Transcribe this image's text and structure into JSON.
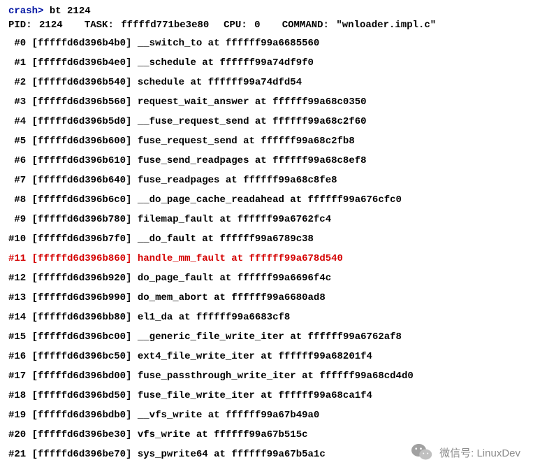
{
  "prompt": {
    "label": "crash>",
    "command": "bt 2124"
  },
  "header": {
    "pid_label": "PID:",
    "pid": "2124",
    "task_label": "TASK:",
    "task": "fffffd771be3e80",
    "cpu_label": "CPU:",
    "cpu": "0",
    "command_label": "COMMAND:",
    "command": "\"wnloader.impl.c\""
  },
  "frames": [
    {
      "num": "#0",
      "ptr": "[fffffd6d396b4b0]",
      "func": "__switch_to",
      "at": "at",
      "addr": "ffffff99a6685560",
      "hl": false
    },
    {
      "num": "#1",
      "ptr": "[fffffd6d396b4e0]",
      "func": "__schedule",
      "at": "at",
      "addr": "ffffff99a74df9f0",
      "hl": false
    },
    {
      "num": "#2",
      "ptr": "[fffffd6d396b540]",
      "func": "schedule",
      "at": "at",
      "addr": "ffffff99a74dfd54",
      "hl": false
    },
    {
      "num": "#3",
      "ptr": "[fffffd6d396b560]",
      "func": "request_wait_answer",
      "at": "at",
      "addr": "ffffff99a68c0350",
      "hl": false
    },
    {
      "num": "#4",
      "ptr": "[fffffd6d396b5d0]",
      "func": "__fuse_request_send",
      "at": "at",
      "addr": "ffffff99a68c2f60",
      "hl": false
    },
    {
      "num": "#5",
      "ptr": "[fffffd6d396b600]",
      "func": "fuse_request_send",
      "at": "at",
      "addr": "ffffff99a68c2fb8",
      "hl": false
    },
    {
      "num": "#6",
      "ptr": "[fffffd6d396b610]",
      "func": "fuse_send_readpages",
      "at": "at",
      "addr": "ffffff99a68c8ef8",
      "hl": false
    },
    {
      "num": "#7",
      "ptr": "[fffffd6d396b640]",
      "func": "fuse_readpages",
      "at": "at",
      "addr": "ffffff99a68c8fe8",
      "hl": false
    },
    {
      "num": "#8",
      "ptr": "[fffffd6d396b6c0]",
      "func": "__do_page_cache_readahead",
      "at": "at",
      "addr": "ffffff99a676cfc0",
      "hl": false
    },
    {
      "num": "#9",
      "ptr": "[fffffd6d396b780]",
      "func": "filemap_fault",
      "at": "at",
      "addr": "ffffff99a6762fc4",
      "hl": false
    },
    {
      "num": "#10",
      "ptr": "[fffffd6d396b7f0]",
      "func": "__do_fault",
      "at": "at",
      "addr": "ffffff99a6789c38",
      "hl": false
    },
    {
      "num": "#11",
      "ptr": "[fffffd6d396b860]",
      "func": "handle_mm_fault",
      "at": "at",
      "addr": "ffffff99a678d540",
      "hl": true
    },
    {
      "num": "#12",
      "ptr": "[fffffd6d396b920]",
      "func": "do_page_fault",
      "at": "at",
      "addr": "ffffff99a6696f4c",
      "hl": false
    },
    {
      "num": "#13",
      "ptr": "[fffffd6d396b990]",
      "func": "do_mem_abort",
      "at": "at",
      "addr": "ffffff99a6680ad8",
      "hl": false
    },
    {
      "num": "#14",
      "ptr": "[fffffd6d396bb80]",
      "func": "el1_da",
      "at": "at",
      "addr": "ffffff99a6683cf8",
      "hl": false
    },
    {
      "num": "#15",
      "ptr": "[fffffd6d396bc00]",
      "func": "__generic_file_write_iter",
      "at": "at",
      "addr": "ffffff99a6762af8",
      "hl": false
    },
    {
      "num": "#16",
      "ptr": "[fffffd6d396bc50]",
      "func": "ext4_file_write_iter",
      "at": "at",
      "addr": "ffffff99a68201f4",
      "hl": false
    },
    {
      "num": "#17",
      "ptr": "[fffffd6d396bd00]",
      "func": "fuse_passthrough_write_iter",
      "at": "at",
      "addr": "ffffff99a68cd4d0",
      "hl": false
    },
    {
      "num": "#18",
      "ptr": "[fffffd6d396bd50]",
      "func": "fuse_file_write_iter",
      "at": "at",
      "addr": "ffffff99a68ca1f4",
      "hl": false
    },
    {
      "num": "#19",
      "ptr": "[fffffd6d396bdb0]",
      "func": "__vfs_write",
      "at": "at",
      "addr": "ffffff99a67b49a0",
      "hl": false
    },
    {
      "num": "#20",
      "ptr": "[fffffd6d396be30]",
      "func": "vfs_write",
      "at": "at",
      "addr": "ffffff99a67b515c",
      "hl": false
    },
    {
      "num": "#21",
      "ptr": "[fffffd6d396be70]",
      "func": "sys_pwrite64",
      "at": "at",
      "addr": "ffffff99a67b5a1c",
      "hl": false
    }
  ],
  "watermark": {
    "label": "微信号:",
    "handle": "LinuxDev"
  }
}
